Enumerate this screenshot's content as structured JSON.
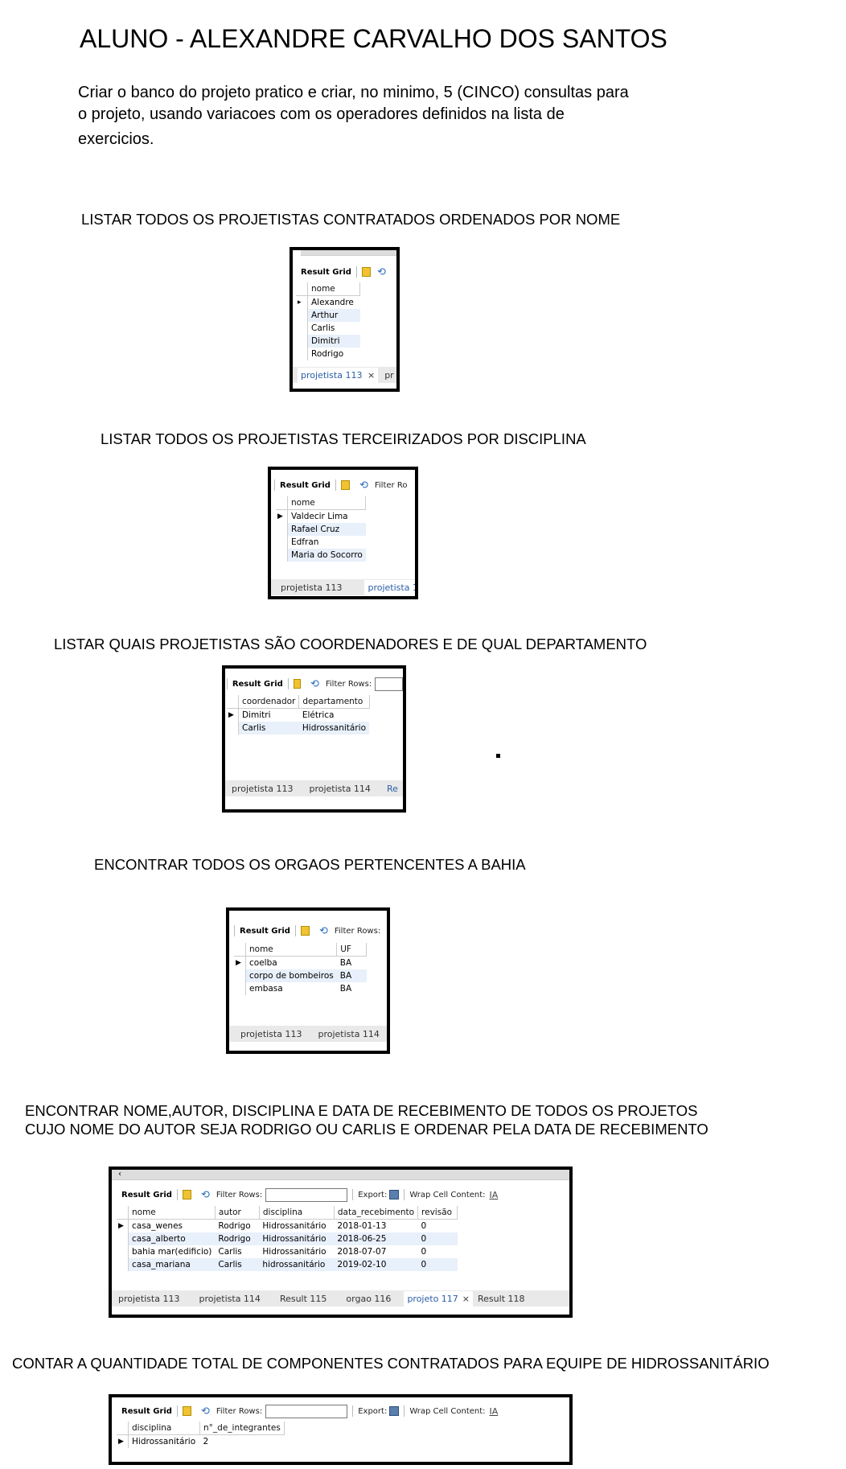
{
  "title": "ALUNO - ALEXANDRE CARVALHO DOS SANTOS",
  "intro": [
    "Criar o banco do projeto pratico e criar, no minimo, 5 (CINCO) consultas para",
    "o projeto, usando variacoes com os operadores definidos na lista de",
    "exercicios."
  ],
  "common": {
    "result_grid": "Result Grid",
    "filter_rows": "Filter Rows:",
    "filter_rows_trunc": "Filter Ro",
    "export": "Export:",
    "wrap": "Wrap Cell Content:",
    "wrap_icon": "IA"
  },
  "q1": {
    "heading": "LISTAR TODOS OS PROJETISTAS CONTRATADOS ORDENADOS POR NOME",
    "columns": [
      "nome"
    ],
    "rows": [
      [
        "Alexandre"
      ],
      [
        "Arthur"
      ],
      [
        "Carlis"
      ],
      [
        "Dimitri"
      ],
      [
        "Rodrigo"
      ]
    ],
    "tab1": "projetista 113",
    "tab2": "pr"
  },
  "q2": {
    "heading": "LISTAR TODOS OS PROJETISTAS TERCEIRIZADOS POR DISCIPLINA",
    "columns": [
      "nome"
    ],
    "rows": [
      [
        "Valdecir Lima"
      ],
      [
        "Rafael Cruz"
      ],
      [
        "Edfran"
      ],
      [
        "Maria do Socorro"
      ]
    ],
    "tab1": "projetista 113",
    "tab2": "projetista 1:"
  },
  "q3": {
    "heading": "LISTAR QUAIS PROJETISTAS SÃO COORDENADORES E DE QUAL DEPARTAMENTO",
    "columns": [
      "coordenador",
      "departamento"
    ],
    "rows": [
      [
        "Dimitri",
        "Elétrica"
      ],
      [
        "Carlis",
        "Hidrossanitário"
      ]
    ],
    "tab1": "projetista 113",
    "tab2": "projetista 114",
    "tab3": "Re"
  },
  "q4": {
    "heading": "ENCONTRAR TODOS OS ORGAOS PERTENCENTES A BAHIA",
    "columns": [
      "nome",
      "UF"
    ],
    "rows": [
      [
        "coelba",
        "BA"
      ],
      [
        "corpo de bombeiros",
        "BA"
      ],
      [
        "embasa",
        "BA"
      ]
    ],
    "tab1": "projetista 113",
    "tab2": "projetista 114"
  },
  "q5": {
    "heading1": "ENCONTRAR NOME,AUTOR, DISCIPLINA E DATA DE RECEBIMENTO DE TODOS OS PROJETOS",
    "heading2": "CUJO NOME DO AUTOR SEJA RODRIGO OU CARLIS E ORDENAR PELA DATA DE RECEBIMENTO",
    "columns": [
      "nome",
      "autor",
      "disciplina",
      "data_recebimento",
      "revisão"
    ],
    "rows": [
      [
        "casa_wenes",
        "Rodrigo",
        "Hidrossanitário",
        "2018-01-13",
        "0"
      ],
      [
        "casa_alberto",
        "Rodrigo",
        "Hidrossanitário",
        "2018-06-25",
        "0"
      ],
      [
        "bahia mar(edificio)",
        "Carlis",
        "Hidrossanitário",
        "2018-07-07",
        "0"
      ],
      [
        "casa_mariana",
        "Carlis",
        "hidrossanitário",
        "2019-02-10",
        "0"
      ]
    ],
    "tabs": [
      "projetista 113",
      "projetista 114",
      "Result 115",
      "orgao 116",
      "projeto 117",
      "Result 118"
    ]
  },
  "q6": {
    "heading": "CONTAR A QUANTIDADE TOTAL DE COMPONENTES CONTRATADOS PARA EQUIPE DE HIDROSSANITÁRIO",
    "columns": [
      "disciplina",
      "n°_de_integrantes"
    ],
    "rows": [
      [
        "Hidrossanitário",
        "2"
      ]
    ]
  }
}
